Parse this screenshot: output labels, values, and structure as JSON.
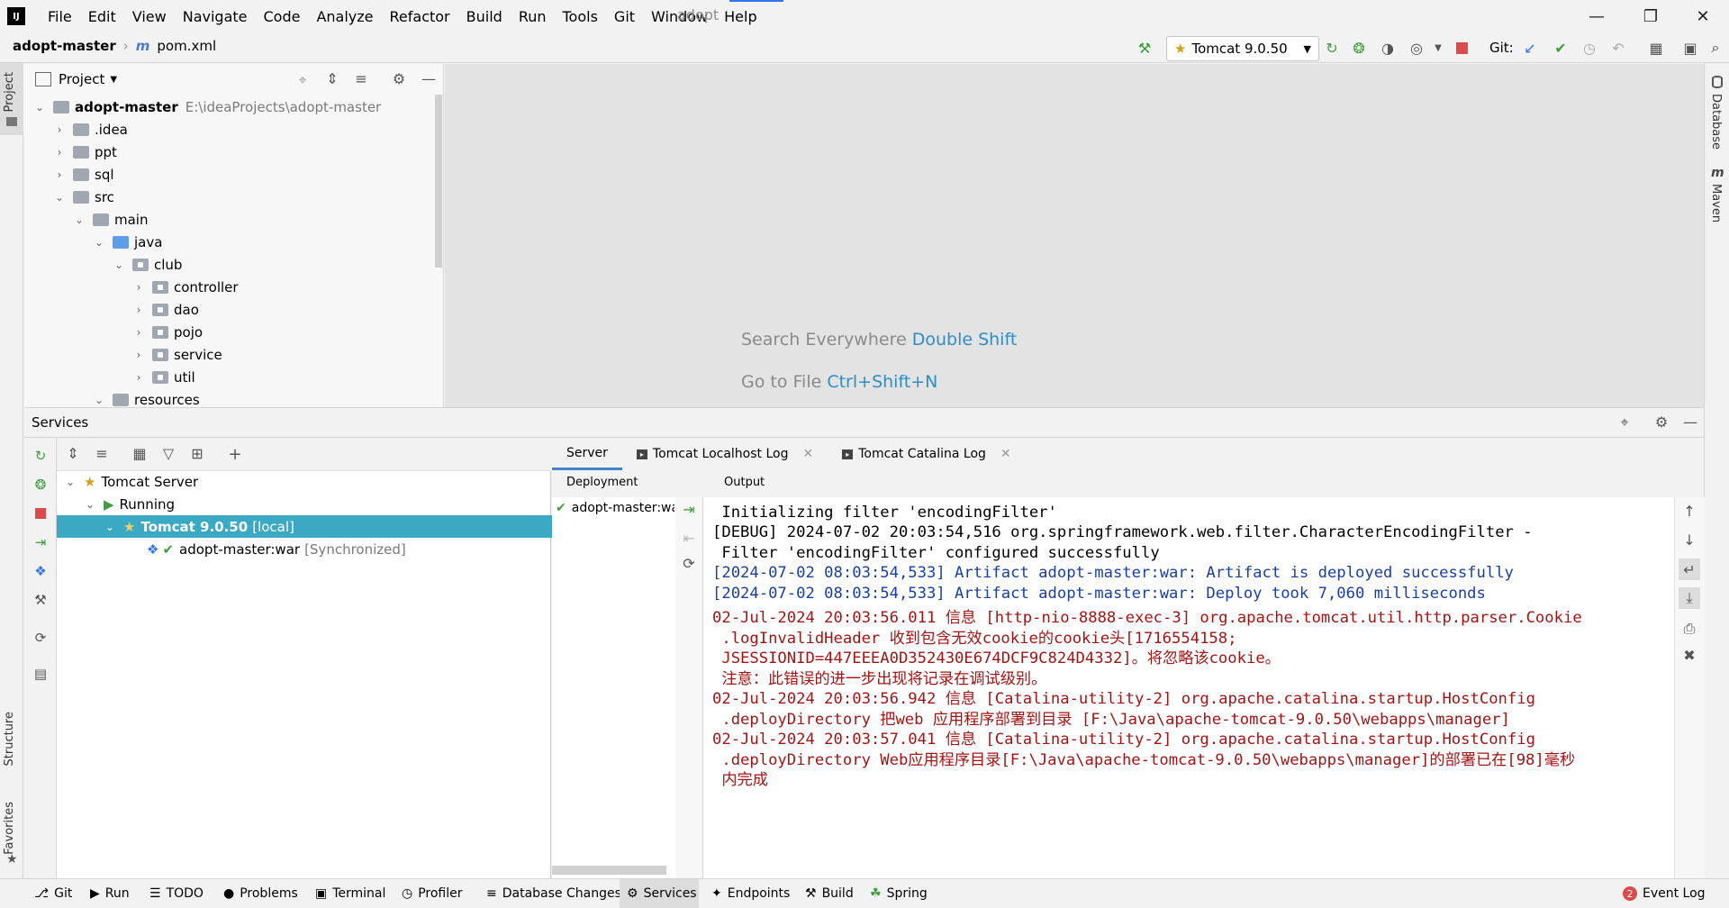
{
  "window": {
    "app_title": "adopt",
    "menu": [
      "File",
      "Edit",
      "View",
      "Navigate",
      "Code",
      "Analyze",
      "Refactor",
      "Build",
      "Run",
      "Tools",
      "Git",
      "Window",
      "Help"
    ]
  },
  "toolbar": {
    "project_name": "adopt-master",
    "file_name": "pom.xml",
    "run_config": "Tomcat 9.0.50",
    "git_label": "Git:"
  },
  "side_tabs": {
    "left_top": "Project",
    "left_structure": "Structure",
    "left_favorites": "Favorites",
    "right_database": "Database",
    "right_maven": "Maven"
  },
  "project": {
    "header_label": "Project",
    "tree": [
      {
        "label": "adopt-master",
        "path": "E:\\ideaProjects\\adopt-master"
      },
      {
        "label": ".idea"
      },
      {
        "label": "ppt"
      },
      {
        "label": "sql"
      },
      {
        "label": "src"
      },
      {
        "label": "main"
      },
      {
        "label": "java"
      },
      {
        "label": "club"
      },
      {
        "label": "controller"
      },
      {
        "label": "dao"
      },
      {
        "label": "pojo"
      },
      {
        "label": "service"
      },
      {
        "label": "util"
      },
      {
        "label": "resources"
      }
    ]
  },
  "editor_hints": [
    {
      "text": "Search Everywhere",
      "key": "Double Shift"
    },
    {
      "text": "Go to File",
      "key": "Ctrl+Shift+N"
    }
  ],
  "services": {
    "title": "Services",
    "tree": [
      {
        "label": "Tomcat Server"
      },
      {
        "label": "Running"
      },
      {
        "label": "Tomcat 9.0.50",
        "suffix": "[local]"
      },
      {
        "label": "adopt-master:war",
        "suffix": "[Synchronized]"
      }
    ],
    "tabs": [
      "Server",
      "Tomcat Localhost Log",
      "Tomcat Catalina Log"
    ],
    "deployment_header": "Deployment",
    "output_header": "Output",
    "deployment_item": "adopt-master:war",
    "output_lines": [
      {
        "text": " Initializing filter 'encodingFilter'",
        "color": "#000000"
      },
      {
        "text": "[DEBUG] 2024-07-02 20:03:54,516 org.springframework.web.filter.CharacterEncodingFilter -",
        "color": "#000000"
      },
      {
        "text": " Filter 'encodingFilter' configured successfully",
        "color": "#000000"
      },
      {
        "text": "[2024-07-02 08:03:54,533] Artifact adopt-master:war: Artifact is deployed successfully",
        "color": "#1a3fa3"
      },
      {
        "text": "[2024-07-02 08:03:54,533] Artifact adopt-master:war: Deploy took 7,060 milliseconds",
        "color": "#1a3fa3"
      },
      {
        "text": "02-Jul-2024 20:03:56.011 信息 [http-nio-8888-exec-3] org.apache.tomcat.util.http.parser.Cookie",
        "color": "#a31515"
      },
      {
        "text": " .logInvalidHeader 收到包含无效cookie的cookie头[1716554158;",
        "color": "#a31515"
      },
      {
        "text": " JSESSIONID=447EEEA0D352430E674DCF9C824D4332]。将忽略该cookie。",
        "color": "#a31515"
      },
      {
        "text": " 注意：此错误的进一步出现将记录在调试级别。",
        "color": "#a31515"
      },
      {
        "text": "02-Jul-2024 20:03:56.942 信息 [Catalina-utility-2] org.apache.catalina.startup.HostConfig",
        "color": "#a31515"
      },
      {
        "text": " .deployDirectory 把web 应用程序部署到目录 [F:\\Java\\apache-tomcat-9.0.50\\webapps\\manager]",
        "color": "#a31515"
      },
      {
        "text": "02-Jul-2024 20:03:57.041 信息 [Catalina-utility-2] org.apache.catalina.startup.HostConfig",
        "color": "#a31515"
      },
      {
        "text": " .deployDirectory Web应用程序目录[F:\\Java\\apache-tomcat-9.0.50\\webapps\\manager]的部署已在[98]毫秒",
        "color": "#a31515"
      },
      {
        "text": " 内完成",
        "color": "#a31515"
      }
    ]
  },
  "statusbar": {
    "items": [
      "Git",
      "Run",
      "TODO",
      "Problems",
      "Terminal",
      "Profiler",
      "Database Changes",
      "Services",
      "Endpoints",
      "Build",
      "Spring"
    ],
    "event_log": "Event Log",
    "event_count": "2"
  },
  "colors": {
    "selection": "#3ba8c4",
    "accent": "#3574f0",
    "log_blue": "#1a3fa3",
    "log_red": "#a31515"
  }
}
